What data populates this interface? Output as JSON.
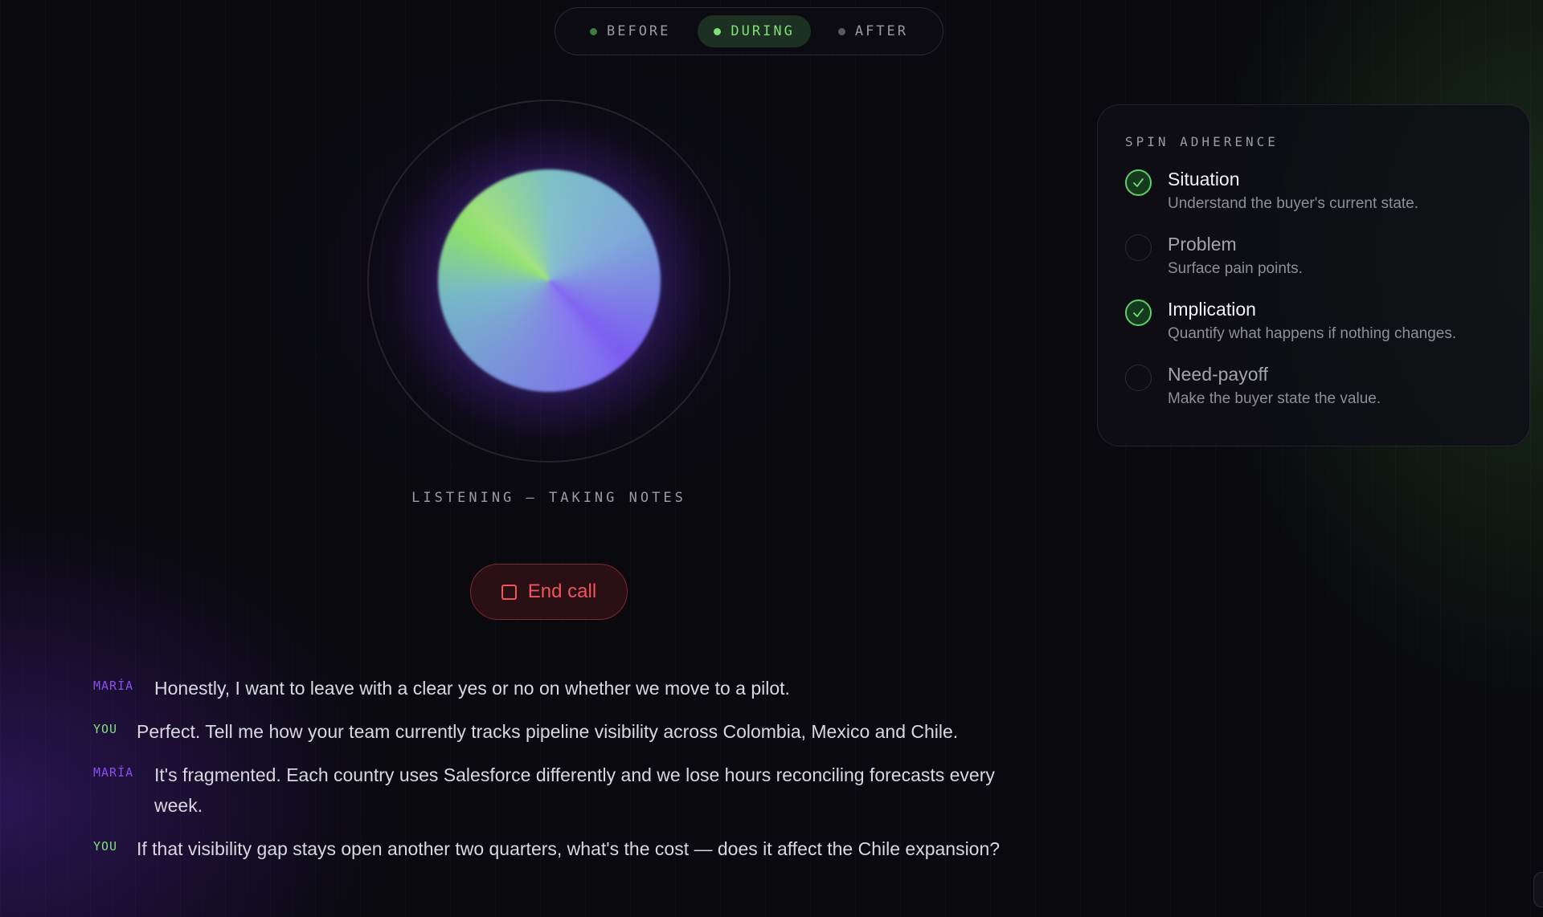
{
  "phases": [
    {
      "label": "BEFORE",
      "active": false
    },
    {
      "label": "DURING",
      "active": true
    },
    {
      "label": "AFTER",
      "active": false
    }
  ],
  "orb": {
    "status": "LISTENING — TAKING NOTES"
  },
  "end_call": {
    "label": "End call"
  },
  "spin": {
    "title": "SPIN ADHERENCE",
    "items": [
      {
        "name": "Situation",
        "desc": "Understand the buyer's current state.",
        "done": true
      },
      {
        "name": "Problem",
        "desc": "Surface pain points.",
        "done": false
      },
      {
        "name": "Implication",
        "desc": "Quantify what happens if nothing changes.",
        "done": true
      },
      {
        "name": "Need-payoff",
        "desc": "Make the buyer state the value.",
        "done": false
      }
    ]
  },
  "transcript": [
    {
      "speaker": "MARÍA",
      "role": "maria",
      "text": "Honestly, I want to leave with a clear yes or no on whether we move to a pilot."
    },
    {
      "speaker": "YOU",
      "role": "you",
      "text": "Perfect. Tell me how your team currently tracks pipeline visibility across Colombia, Mexico and Chile."
    },
    {
      "speaker": "MARÍA",
      "role": "maria",
      "text": "It's fragmented. Each country uses Salesforce differently and we lose hours reconciling forecasts every week."
    },
    {
      "speaker": "YOU",
      "role": "you",
      "text": "If that visibility gap stays open another two quarters, what's the cost — does it affect the Chile expansion?"
    }
  ],
  "colors": {
    "accent_green": "#7fe07a",
    "accent_purple": "#8a4cf0",
    "danger_red": "#f0545e"
  }
}
